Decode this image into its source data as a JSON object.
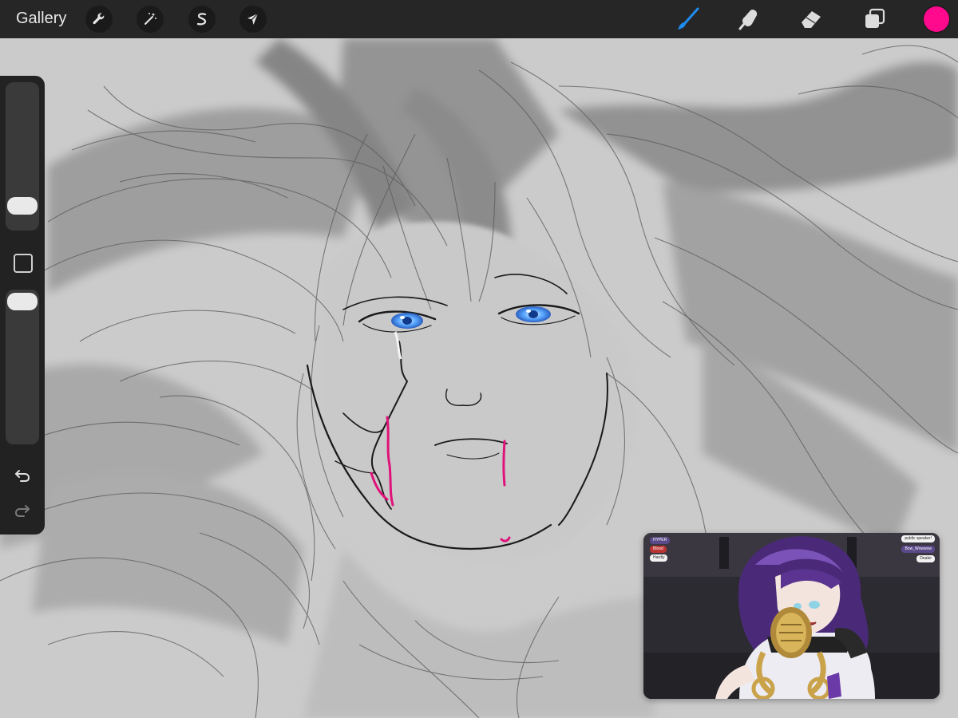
{
  "toolbar": {
    "gallery_label": "Gallery",
    "left_tools": [
      {
        "name": "actions",
        "icon": "wrench-icon"
      },
      {
        "name": "adjustments",
        "icon": "magic-wand-icon"
      },
      {
        "name": "selection",
        "icon": "selection-s-icon"
      },
      {
        "name": "transform",
        "icon": "arrow-cursor-icon"
      }
    ],
    "right_tools": [
      {
        "name": "brush",
        "icon": "brush-icon",
        "active": true
      },
      {
        "name": "smudge",
        "icon": "smudge-icon"
      },
      {
        "name": "eraser",
        "icon": "eraser-icon"
      },
      {
        "name": "layers",
        "icon": "layers-icon"
      }
    ],
    "current_color": "#ff0a8c",
    "active_tool_color": "#1f8cf0"
  },
  "sidebar": {
    "brush_size_level": 0.1,
    "opacity_level": 1.0,
    "icons": [
      "modifier-square-icon",
      "undo-icon",
      "redo-icon"
    ]
  },
  "pip": {
    "chat_left": [
      "HYPER",
      "Blood",
      "Hardly"
    ],
    "chat_right": [
      "public speaker!",
      "Bow_Wowwow",
      "Dealer"
    ]
  },
  "colors": {
    "eye_blue": "#5aa8ff",
    "blood_magenta": "#e0127a",
    "canvas_gray": "#cbcbcb"
  }
}
